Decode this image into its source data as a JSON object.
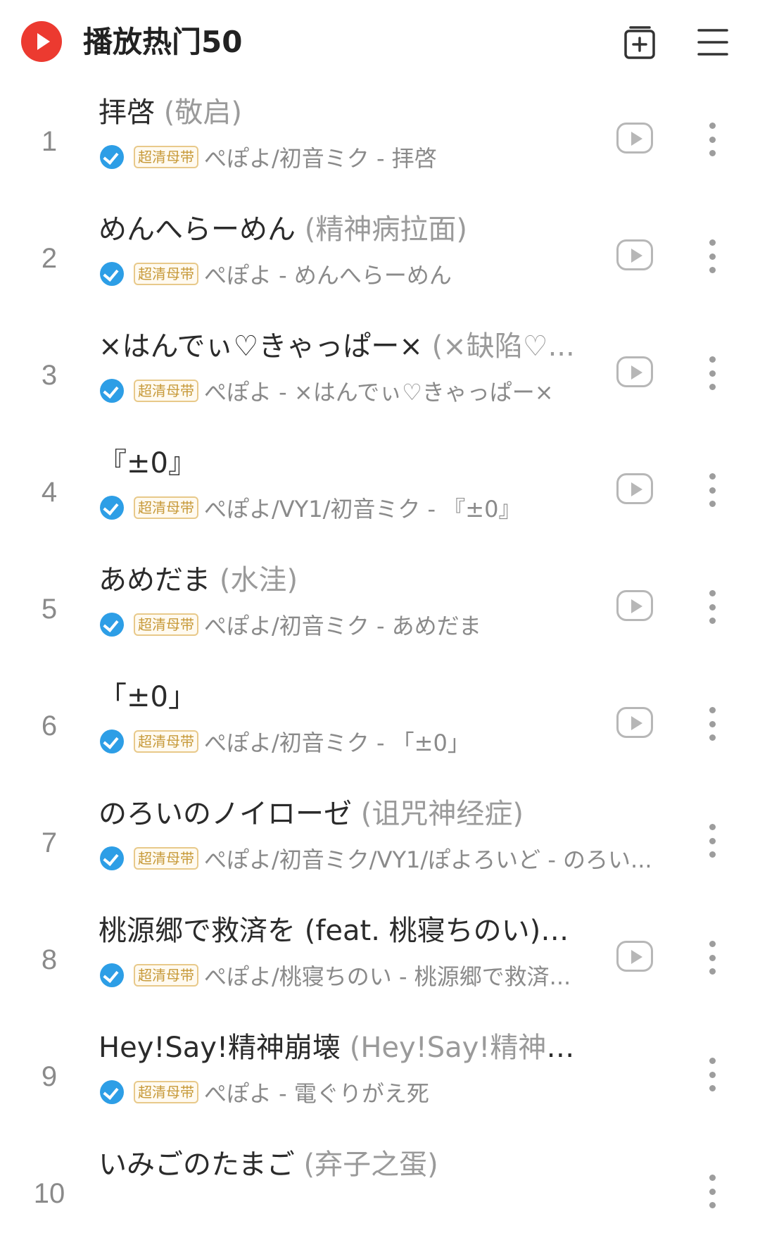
{
  "header": {
    "title": "播放热门50"
  },
  "songs": [
    {
      "rank": "1",
      "title": "拝啓",
      "alias": " (敬启)",
      "quality": "超清母带",
      "artist": "ぺぽよ/初音ミク - 拝啓",
      "has_mv": true
    },
    {
      "rank": "2",
      "title": "めんへらーめん",
      "alias": " (精神病拉面)",
      "quality": "超清母带",
      "artist": "ぺぽよ - めんへらーめん",
      "has_mv": true
    },
    {
      "rank": "3",
      "title": "×はんでぃ♡きゃっぱー×",
      "alias": " (×缺陷♡...",
      "quality": "超清母带",
      "artist": "ぺぽよ - ×はんでぃ♡きゃっぱー×",
      "has_mv": true
    },
    {
      "rank": "4",
      "title": "『±0』",
      "alias": "",
      "quality": "超清母带",
      "artist": "ぺぽよ/VY1/初音ミク - 『±0』",
      "has_mv": true
    },
    {
      "rank": "5",
      "title": "あめだま",
      "alias": " (水洼)",
      "quality": "超清母带",
      "artist": "ぺぽよ/初音ミク - あめだま",
      "has_mv": true
    },
    {
      "rank": "6",
      "title": "「±0」",
      "alias": "",
      "quality": "超清母带",
      "artist": "ぺぽよ/初音ミク - 「±0」",
      "has_mv": true
    },
    {
      "rank": "7",
      "title": "のろいのノイローゼ",
      "alias": " (诅咒神经症)",
      "quality": "超清母带",
      "artist": "ぺぽよ/初音ミク/VY1/ぽよろいど - のろい...",
      "has_mv": false
    },
    {
      "rank": "8",
      "title": "桃源郷で救済を (feat. 桃寝ちのい)",
      "alias": " (...",
      "quality": "超清母带",
      "artist": "ぺぽよ/桃寝ちのい - 桃源郷で救済...",
      "has_mv": true
    },
    {
      "rank": "9",
      "title": "Hey!Say!精神崩壊",
      "alias": " (Hey!Say!精神崩坏)",
      "quality": "超清母带",
      "artist": "ぺぽよ - 電ぐりがえ死",
      "has_mv": false
    },
    {
      "rank": "10",
      "title": "いみごのたまご",
      "alias": " (弃子之蛋)",
      "quality": "",
      "artist": "",
      "has_mv": false
    }
  ]
}
